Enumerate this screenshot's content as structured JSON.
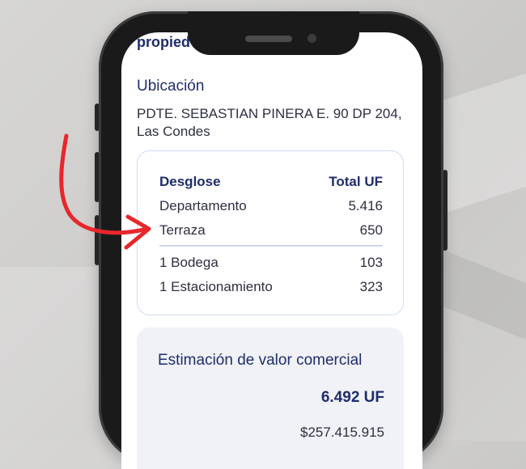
{
  "app": {
    "brand_text": "propied"
  },
  "location": {
    "title": "Ubicación",
    "address": "PDTE. SEBASTIAN PINERA E. 90 DP 204, Las Condes"
  },
  "breakdown": {
    "header_label": "Desglose",
    "header_total": "Total UF",
    "rows": [
      {
        "label": "Departamento",
        "value": "5.416"
      },
      {
        "label": "Terraza",
        "value": "650"
      },
      {
        "label": "1 Bodega",
        "value": "103"
      },
      {
        "label": "1 Estacionamiento",
        "value": "323"
      }
    ]
  },
  "estimate": {
    "title": "Estimación de valor comercial",
    "value_uf": "6.492 UF",
    "value_clp": "$257.415.915"
  },
  "colors": {
    "accent": "#1f2d6b",
    "arrow": "#e8262b",
    "card_border": "#cfdcf5"
  }
}
